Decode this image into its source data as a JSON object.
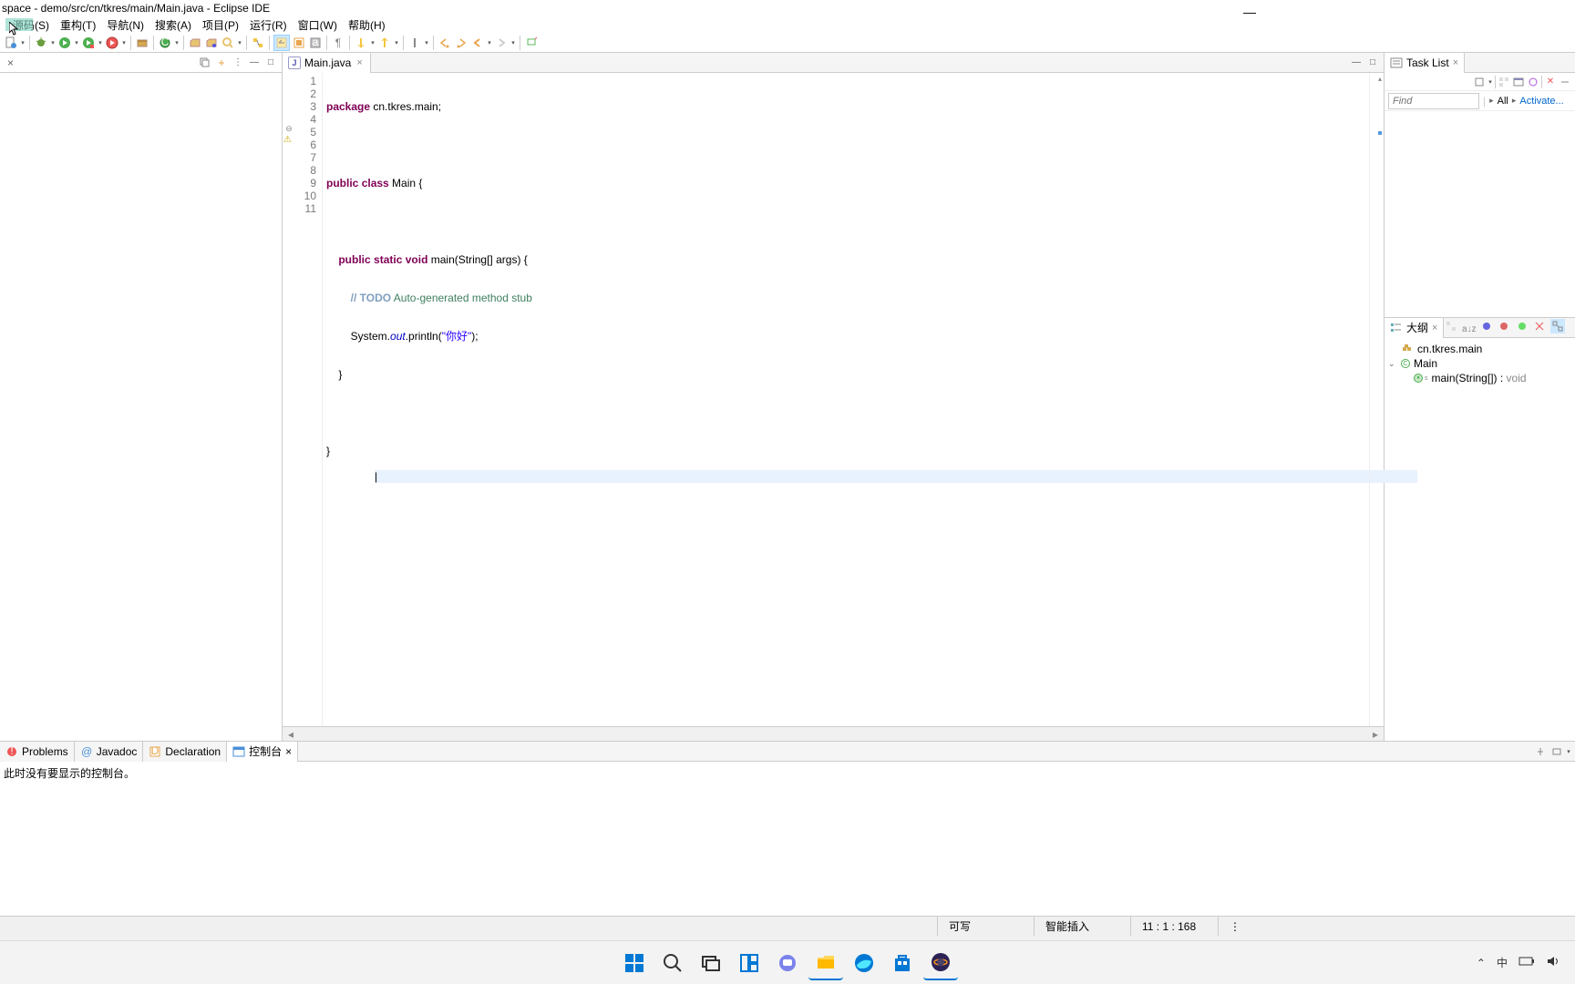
{
  "title": "space - demo/src/cn/tkres/main/Main.java - Eclipse IDE",
  "menu": {
    "source": "源码(S)",
    "refactor": "重构(T)",
    "navigate": "导航(N)",
    "search": "搜索(A)",
    "project": "项目(P)",
    "run": "运行(R)",
    "window": "窗口(W)",
    "help": "帮助(H)"
  },
  "editor": {
    "tab_name": "Main.java",
    "lines": [
      "1",
      "2",
      "3",
      "4",
      "5",
      "6",
      "7",
      "8",
      "9",
      "10",
      "11"
    ],
    "line5_marker": "5⊖",
    "code_package": "package",
    "code_pkg_name": " cn.tkres.main;",
    "code_public": "public",
    "code_class": "class",
    "code_main_cls": " Main {",
    "code_static": "static",
    "code_void": "void",
    "code_main_sig": " main(String[] args) {",
    "code_todo": "// TODO Auto-generated method stub",
    "code_sysout1": "System.",
    "code_out": "out",
    "code_println": ".println(",
    "code_str": "\"你好\"",
    "code_println_end": ");",
    "code_brace_close": "}",
    "code_cursor_line": "{"
  },
  "tasklist": {
    "title": "Task List",
    "find_placeholder": "Find",
    "all_label": "All",
    "activate_label": "Activate..."
  },
  "outline": {
    "title": "大纲",
    "pkg_name": "cn.tkres.main",
    "cls_name": "Main",
    "method_sig": "main(String[]) : ",
    "method_ret": "void"
  },
  "bottom": {
    "problems": "Problems",
    "javadoc": "Javadoc",
    "declaration": "Declaration",
    "console": "控制台",
    "console_msg": "此时没有要显示的控制台。"
  },
  "status": {
    "writable": "可写",
    "insert": "智能插入",
    "pos": "11 : 1 : 168"
  },
  "systray": {
    "ime": "中"
  }
}
